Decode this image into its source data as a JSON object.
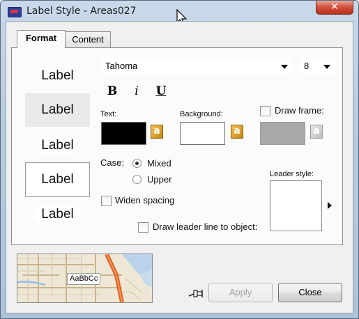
{
  "window": {
    "title": "Label Style - Areas027"
  },
  "tabs": [
    {
      "label": "Format"
    },
    {
      "label": "Content"
    }
  ],
  "previews": [
    {
      "text": "Label"
    },
    {
      "text": "Label"
    },
    {
      "text": "Label"
    },
    {
      "text": "Label"
    },
    {
      "text": "Label"
    }
  ],
  "font": {
    "family": "Tahoma",
    "size": "8"
  },
  "format_buttons": {
    "bold": "B",
    "italic": "i",
    "underline": "U"
  },
  "text_color": {
    "label": "Text:",
    "color": "#000000"
  },
  "background_color": {
    "label": "Background:",
    "color": "#ffffff"
  },
  "frame": {
    "label": "Draw frame:",
    "checked": false,
    "color": "#a8a8a8"
  },
  "case": {
    "label": "Case:",
    "options": [
      "Mixed",
      "Upper"
    ],
    "selected": "Mixed"
  },
  "widen_spacing": {
    "label": "Widen spacing",
    "checked": false
  },
  "leader": {
    "style_label": "Leader style:",
    "draw_line_label": "Draw leader line to object:",
    "checked": false
  },
  "map_preview": {
    "text": "AaBbCc"
  },
  "buttons": {
    "apply": "Apply",
    "close": "Close"
  },
  "colors": {
    "title_bar": "#b7cbe0",
    "close_button": "#c8452e",
    "dialog_bg": "#f0f0f0",
    "panel_bg": "#fbfbfb"
  }
}
